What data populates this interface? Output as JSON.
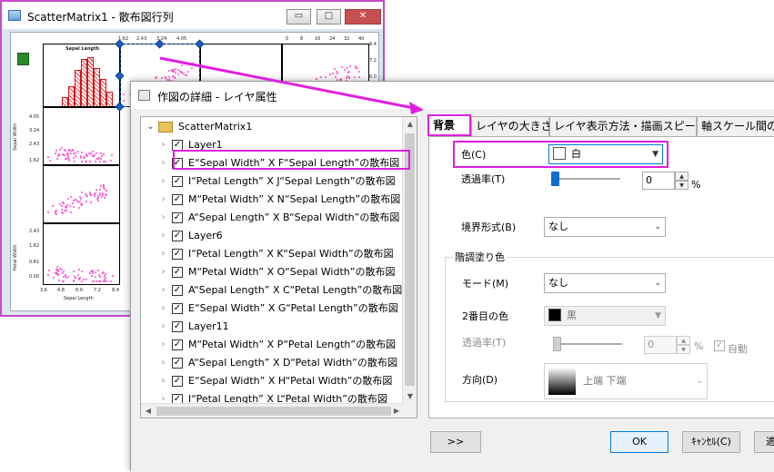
{
  "back_window": {
    "title": "ScatterMatrix1 - 散布図行列",
    "controls": {
      "minimize": "▭",
      "maximize": "□",
      "close": "✕"
    },
    "top_ticks_a": [
      "1.62",
      "2.43",
      "3.24",
      "4.05"
    ],
    "top_ticks_b": [
      "0",
      "8",
      "16",
      "24",
      "32",
      "40"
    ],
    "right_ticks": [
      "8.4",
      "7.2",
      "6.0"
    ],
    "histogram_title": "Sepal Length",
    "row2_ylabel": "Sepal Width",
    "row2_ticks": [
      "4.05",
      "3.24",
      "2.43",
      "1.62"
    ],
    "row4_ylabel": "Petal Width",
    "row4_ticks": [
      "2.43",
      "1.62",
      "0.81",
      "0.00"
    ],
    "bottom_xlabel": "Sepal Length",
    "bottom_ticks": [
      "3.6",
      "4.8",
      "6.0",
      "7.2",
      "8.4"
    ]
  },
  "dialog": {
    "title": "作図の詳細 - レイヤ属性",
    "tree": {
      "root": "ScatterMatrix1",
      "items": [
        {
          "label": "Layer1",
          "checked": true
        },
        {
          "label": "E“Sepal Width” X F“Sepal Length”の散布図",
          "checked": true
        },
        {
          "label": "I“Petal Length” X J“Sepal Length”の散布図",
          "checked": true
        },
        {
          "label": "M“Petal Width” X N“Sepal Length”の散布図",
          "checked": true
        },
        {
          "label": "A“Sepal Length” X B“Sepal Width”の散布図",
          "checked": true
        },
        {
          "label": "Layer6",
          "checked": true
        },
        {
          "label": "I“Petal Length” X K“Sepal Width”の散布図",
          "checked": true
        },
        {
          "label": "M“Petal Width” X O“Sepal Width”の散布図",
          "checked": true
        },
        {
          "label": "A“Sepal Length” X C“Petal Length”の散布図",
          "checked": true
        },
        {
          "label": "E“Sepal Width” X G“Petal Length”の散布図",
          "checked": true
        },
        {
          "label": "Layer11",
          "checked": true
        },
        {
          "label": "M“Petal Width” X P“Petal Length”の散布図",
          "checked": true
        },
        {
          "label": "A“Sepal Length” X D“Petal Width”の散布図",
          "checked": true
        },
        {
          "label": "E“Sepal Width” X H“Petal Width”の散布図",
          "checked": true
        },
        {
          "label": "I“Petal Length” X L“Petal Width”の散布図",
          "checked": true
        }
      ]
    },
    "tabs": [
      "背景",
      "レイヤの大きさ",
      "レイヤ表示方法・描画スピード",
      "軸スケール間の"
    ],
    "background_tab": {
      "color_label": "色(C)",
      "color_value": "白",
      "color_swatch": "#ffffff",
      "transparency_label": "透過率(T)",
      "transparency_value": "0",
      "percent": "%",
      "border_label": "境界形式(B)",
      "border_value": "なし",
      "gradient_group": "階調塗り色",
      "mode_label": "モード(M)",
      "mode_value": "なし",
      "second_color_label": "2番目の色",
      "second_color_value": "黒",
      "second_color_swatch": "#000000",
      "transparency2_label": "透過率(T)",
      "transparency2_value": "0",
      "percent2": "%",
      "auto_label": "自動",
      "direction_label": "方向(D)",
      "direction_value": "上端 下端"
    },
    "buttons": {
      "expand": ">>",
      "ok": "OK",
      "cancel": "ｷｬﾝｾﾙ(C)",
      "apply": "適"
    }
  },
  "colors": {
    "highlight": "#e020e0",
    "scatter_points": "#ff4bd2",
    "histogram": "#d0141e"
  }
}
